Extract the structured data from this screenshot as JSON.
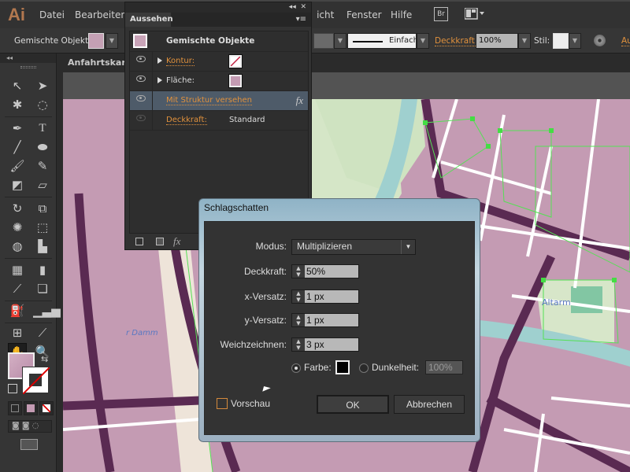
{
  "app": {
    "logo": "Ai"
  },
  "menu": {
    "items": [
      "Datei",
      "Bearbeiten",
      "Ansicht",
      "Fenster",
      "Hilfe"
    ],
    "bridge_label": "Br"
  },
  "control_bar": {
    "selection_label": "Gemischte Objekte",
    "fill_color": "#c4a0b4",
    "stroke_profile": "Einfach",
    "opacity_label": "Deckkraft:",
    "opacity_value": "100%",
    "style_label": "Stil:",
    "align_label": "Au"
  },
  "document": {
    "tab_title": "Anfahrtskarte"
  },
  "appearance_panel": {
    "tab": "Aussehen",
    "title": "Gemischte Objekte",
    "rows": [
      {
        "label": "Kontur:",
        "type": "stroke",
        "link": true
      },
      {
        "label": "Fläche:",
        "type": "fill",
        "link": false
      },
      {
        "label": "Mit Struktur versehen",
        "type": "effect",
        "link": true,
        "fx": "fx"
      },
      {
        "label": "Deckkraft:",
        "value": "Standard",
        "link": true
      }
    ],
    "footer_fx": "fx"
  },
  "dialog": {
    "title": "Schlagschatten",
    "modus_label": "Modus:",
    "modus_value": "Multiplizieren",
    "deckkraft_label": "Deckkraft:",
    "deckkraft_value": "50%",
    "x_label": "x-Versatz:",
    "x_value": "1 px",
    "y_label": "y-Versatz:",
    "y_value": "1 px",
    "blur_label": "Weichzeichnen:",
    "blur_value": "3 px",
    "farbe_label": "Farbe:",
    "farbe_color": "#000000",
    "farbe_selected": true,
    "dunkelheit_label": "Dunkelheit:",
    "dunkelheit_value": "100%",
    "preview_label": "Vorschau",
    "preview_checked": false,
    "ok_label": "OK",
    "cancel_label": "Abbrechen"
  },
  "map": {
    "labels": [
      "Altarm",
      "r Damm"
    ]
  },
  "colors": {
    "accent_orange": "#e0913d",
    "map_fill": "#c49bb3",
    "road_dark": "#5a2a52",
    "selection_green": "#55e055"
  }
}
